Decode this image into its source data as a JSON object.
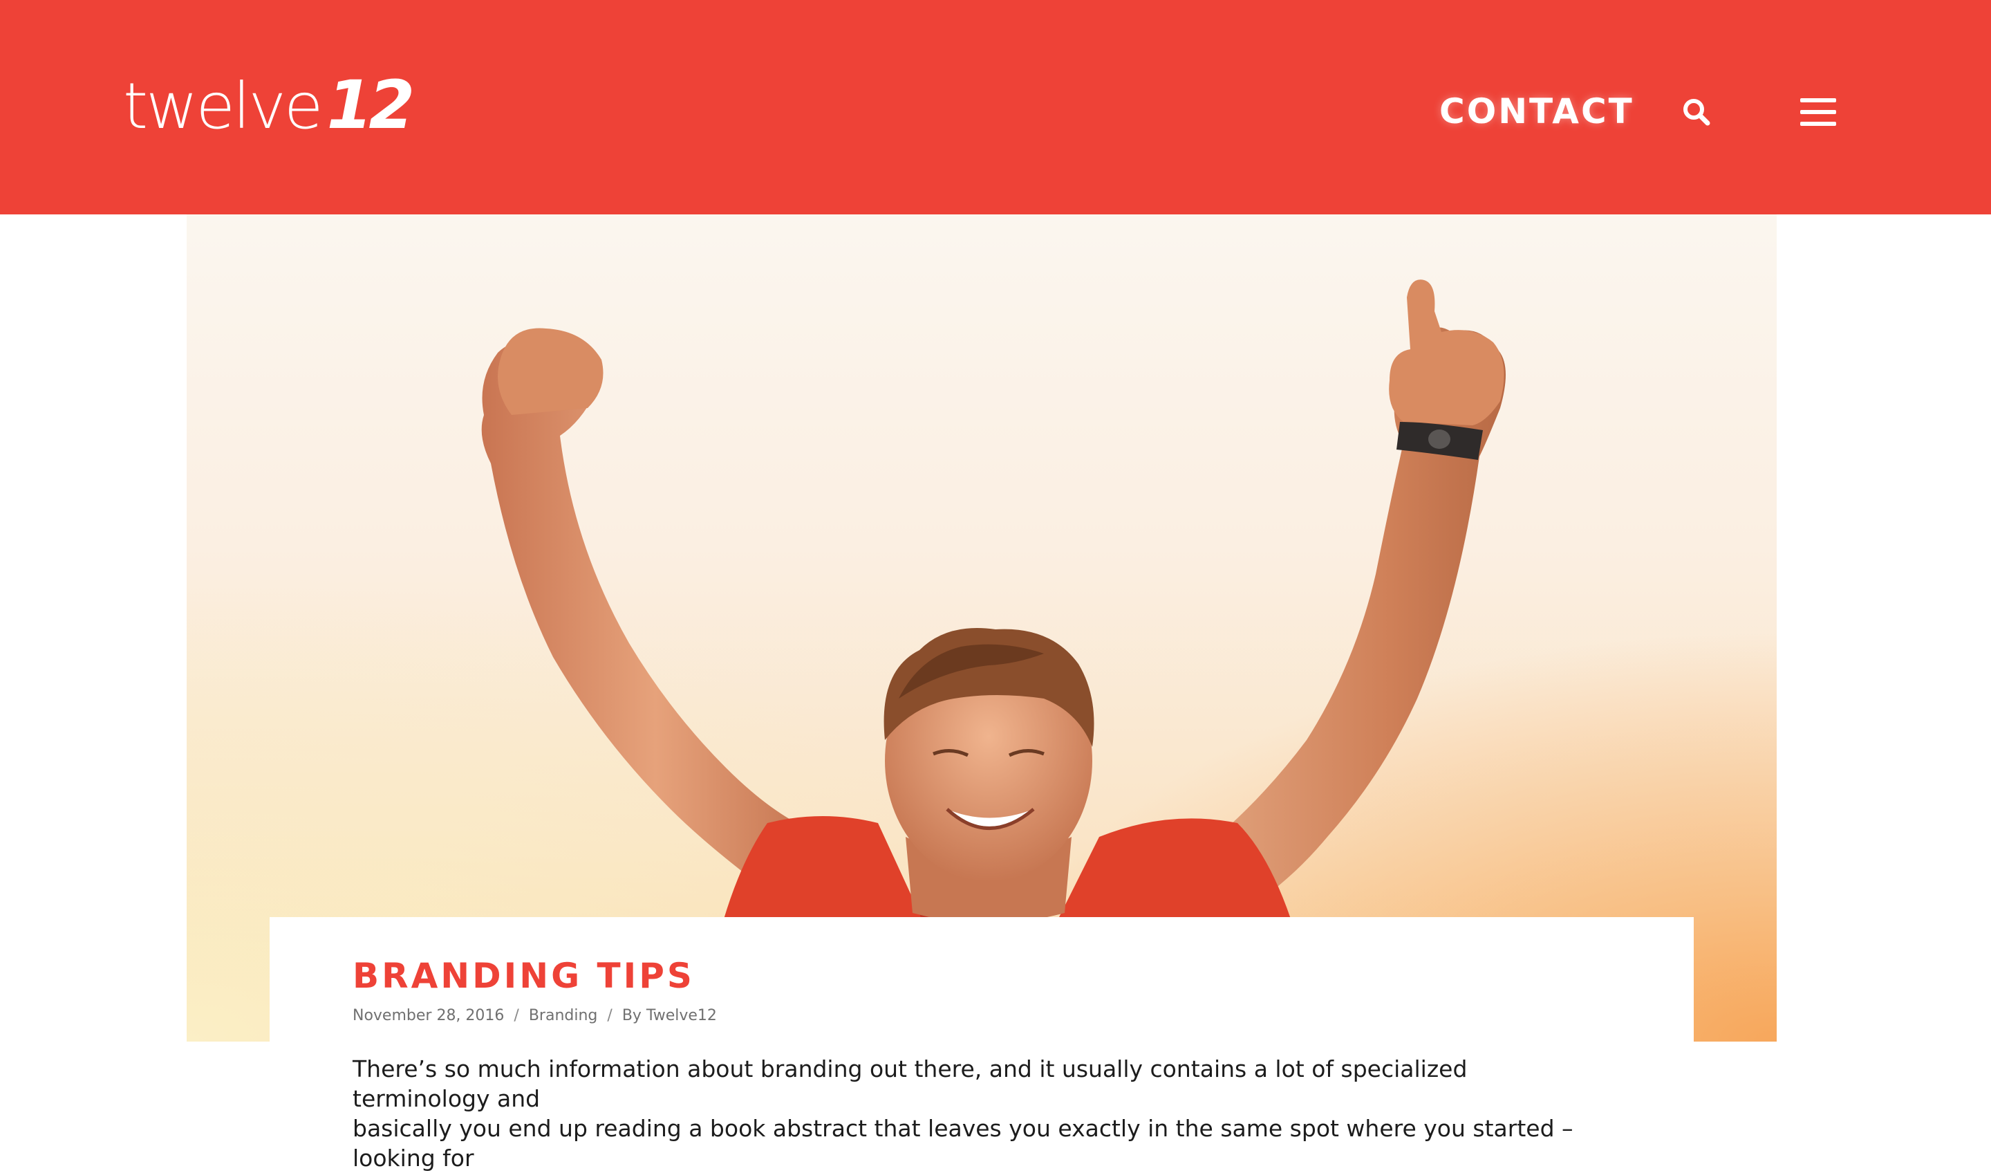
{
  "colors": {
    "brand": "#ee4237",
    "header_text": "#ffffff",
    "meta_text": "#707070",
    "body_text": "#1c1c1c"
  },
  "header": {
    "logo": {
      "word": "twelve",
      "mark": "12"
    },
    "nav": {
      "contact_label": "CONTACT",
      "search_icon": "search-icon",
      "menu_icon": "hamburger-menu-icon"
    }
  },
  "hero": {
    "image_subject": "man-raising-fists-celebrating"
  },
  "post": {
    "title": "BRANDING TIPS",
    "date": "November 28, 2016",
    "separator": "/",
    "category": "Branding",
    "author": "By Twelve12",
    "body_line_1": "There’s so much information about branding out there, and it usually contains a lot of specialized terminology and",
    "body_line_2": "basically you end up reading a book abstract that leaves you exactly in the same spot where you started – looking for"
  }
}
